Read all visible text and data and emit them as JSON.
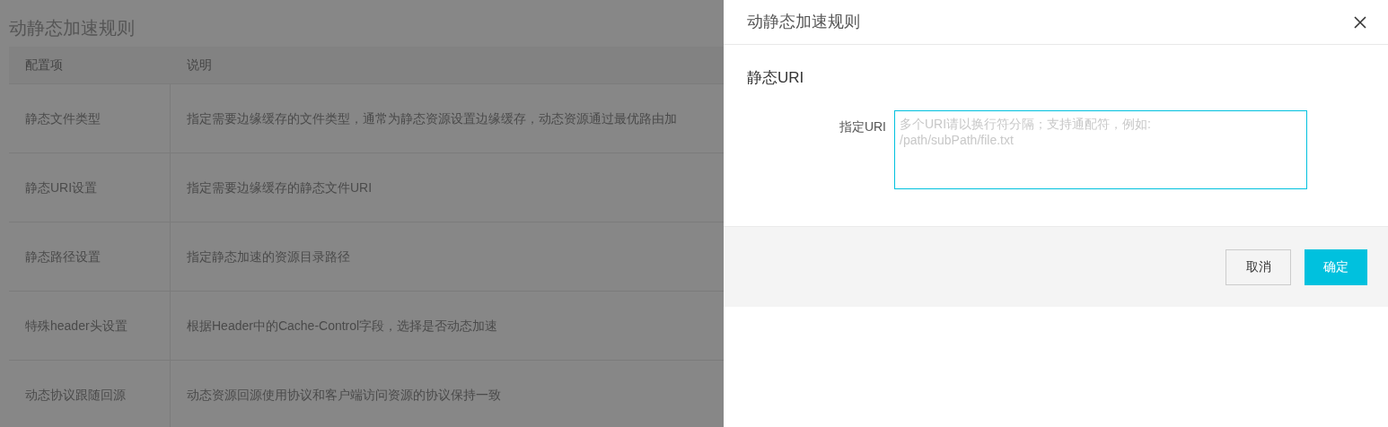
{
  "page": {
    "title": "动静态加速规则",
    "table": {
      "columns": [
        "配置项",
        "说明"
      ],
      "rows": [
        {
          "item": "静态文件类型",
          "description": "指定需要边缘缓存的文件类型，通常为静态资源设置边缘缓存，动态资源通过最优路由加"
        },
        {
          "item": "静态URI设置",
          "description": "指定需要边缘缓存的静态文件URI"
        },
        {
          "item": "静态路径设置",
          "description": "指定静态加速的资源目录路径"
        },
        {
          "item": "特殊header头设置",
          "description": "根据Header中的Cache-Control字段，选择是否动态加速"
        },
        {
          "item": "动态协议跟随回源",
          "description": "动态资源回源使用协议和客户端访问资源的协议保持一致"
        }
      ]
    }
  },
  "drawer": {
    "title": "动静态加速规则",
    "section_title": "静态URI",
    "field": {
      "label": "指定URI",
      "placeholder": "多个URI请以换行符分隔；支持通配符，例如:\n/path/subPath/file.txt"
    },
    "buttons": [
      {
        "label": "取消",
        "kind": "secondary"
      },
      {
        "label": "确定",
        "kind": "primary"
      }
    ]
  }
}
